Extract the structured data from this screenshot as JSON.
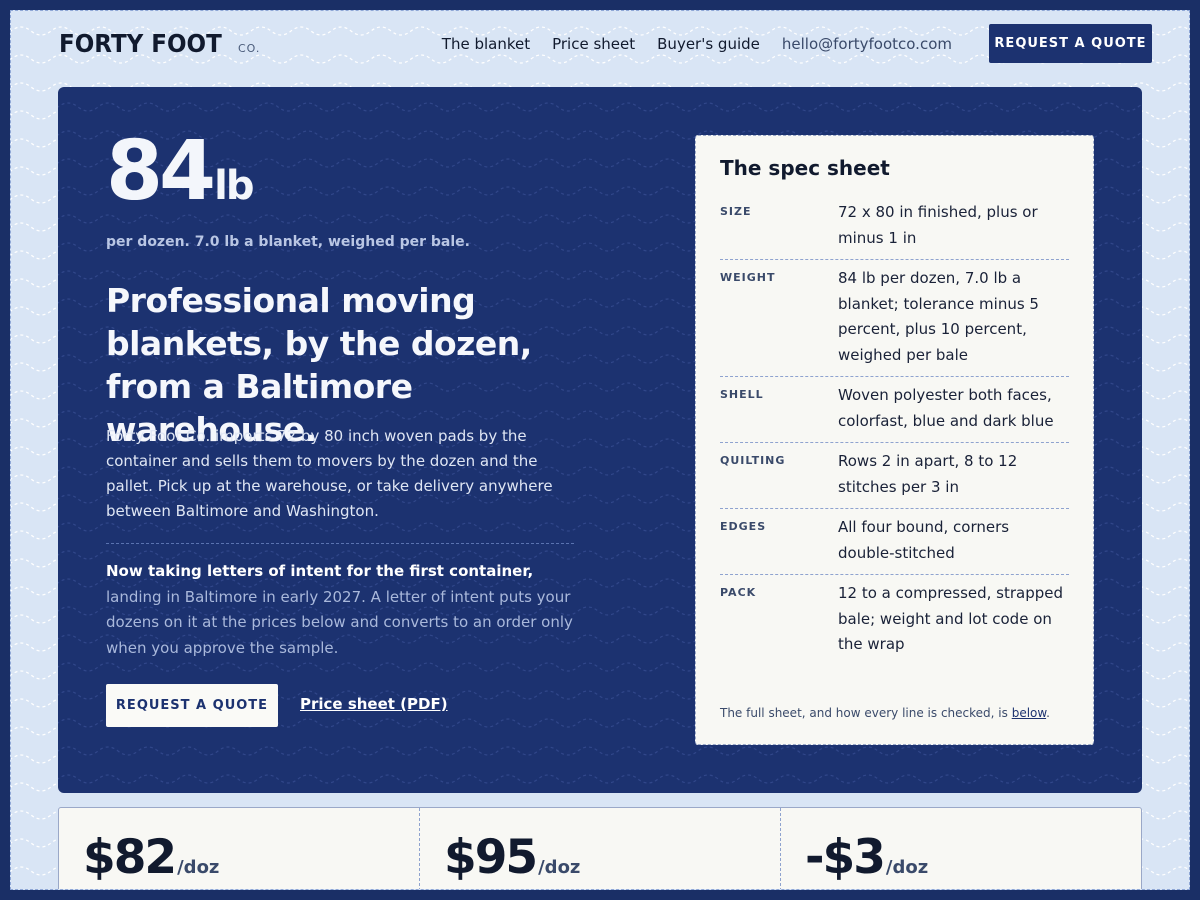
{
  "header": {
    "logo": "FORTY FOOT",
    "logo_sub": "CO.",
    "nav": [
      "The blanket",
      "Price sheet",
      "Buyer's guide"
    ],
    "email": "hello@fortyfootco.com",
    "cta": "REQUEST A QUOTE"
  },
  "hero": {
    "big_number": "84",
    "big_unit": "lb",
    "per_line": "per dozen. 7.0 lb a blanket, weighed per bale.",
    "headline": "Professional moving blankets, by the dozen, from a Baltimore warehouse.",
    "intro": "Forty Foot Co. imports 72 by 80 inch woven pads by the container and sells them to movers by the dozen and the pallet. Pick up at the warehouse, or take delivery anywhere between Baltimore and Washington.",
    "loi_bold": "Now taking letters of intent for the first container,",
    "loi_rest": " landing in Baltimore in early 2027. A letter of intent puts your dozens on it at the prices below and converts to an order only when you approve the sample.",
    "cta": "REQUEST A QUOTE",
    "link": "Price sheet (PDF)"
  },
  "spec": {
    "title": "The spec sheet",
    "rows": [
      {
        "key": "SIZE",
        "value": "72 x 80 in finished, plus or minus 1 in"
      },
      {
        "key": "WEIGHT",
        "value": "84 lb per dozen, 7.0 lb a blanket; tolerance minus 5 percent, plus 10 percent, weighed per bale"
      },
      {
        "key": "SHELL",
        "value": "Woven polyester both faces, colorfast, blue and dark blue"
      },
      {
        "key": "QUILTING",
        "value": "Rows 2 in apart, 8 to 12 stitches per 3 in"
      },
      {
        "key": "EDGES",
        "value": "All four bound, corners double-stitched"
      },
      {
        "key": "PACK",
        "value": "12 to a compressed, strapped bale; weight and lot code on the wrap"
      }
    ],
    "foot_text": "The full sheet, and how every line is checked, is ",
    "foot_link": "below",
    "foot_end": "."
  },
  "prices": [
    {
      "amount": "$82",
      "unit": "/doz"
    },
    {
      "amount": "$95",
      "unit": "/doz"
    },
    {
      "amount": "-$3",
      "unit": "/doz"
    }
  ],
  "colors": {
    "navy": "#1c3270",
    "page_bg": "#d9e5f5",
    "card_bg": "#f8f8f4"
  }
}
